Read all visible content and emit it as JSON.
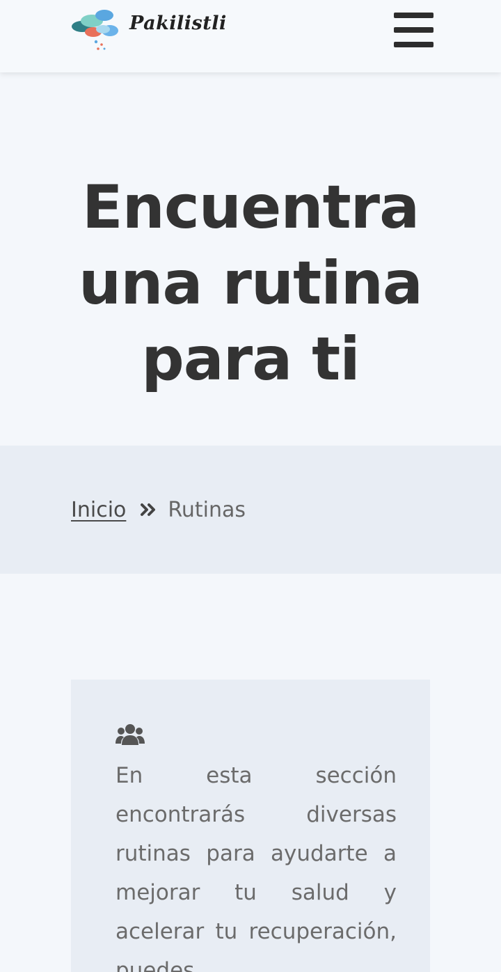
{
  "header": {
    "logo_text": "Pakilistli",
    "logo_icon": "pills-cloud-logo-icon",
    "menu_icon": "hamburger-menu-icon"
  },
  "hero": {
    "title_line1": "Encuentra",
    "title_line2": "una rutina",
    "title_line3": "para ti"
  },
  "breadcrumb": {
    "home": "Inicio",
    "separator_icon": "double-chevron-right-icon",
    "current": "Rutinas"
  },
  "card": {
    "icon": "users-icon",
    "text": "En esta sección encontrarás diversas rutinas para ayudarte a mejorar tu salud y acelerar tu recuperación, puedes"
  },
  "colors": {
    "background": "#f4f7fb",
    "band": "#e8edf4",
    "heading": "#333333",
    "body_text": "#6b6b6b",
    "logo_teal": "#2f7f86",
    "logo_blue": "#5aa7e0",
    "logo_coral": "#e8705a"
  }
}
